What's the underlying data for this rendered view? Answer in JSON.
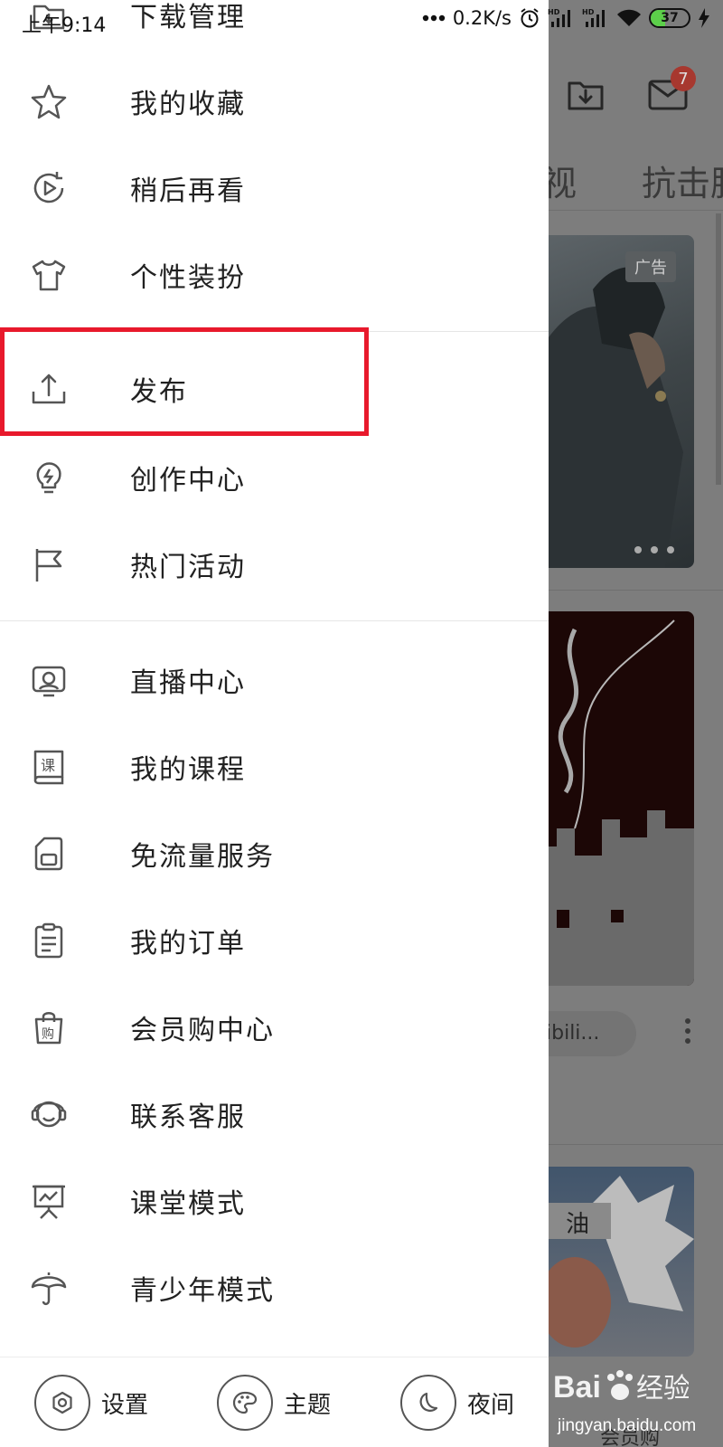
{
  "status_bar": {
    "time": "上午9:14",
    "network_speed": "0.2K/s",
    "battery_level": "37",
    "icons": [
      "dots-icon",
      "alarm-icon",
      "signal-hd-icon",
      "signal-hd-icon",
      "wifi-icon",
      "battery-icon",
      "charging-icon"
    ]
  },
  "background": {
    "tabs": [
      "视",
      "抗击肺"
    ],
    "ad_badge": "广告",
    "card_text": "ibili...",
    "mail_badge": "7",
    "bottom_partial": "会员购"
  },
  "drawer": {
    "items_top": [
      {
        "label": "下载管理",
        "icon": "download-folder-icon"
      },
      {
        "label": "我的收藏",
        "icon": "star-icon"
      },
      {
        "label": "稍后再看",
        "icon": "watch-later-icon"
      },
      {
        "label": "个性装扮",
        "icon": "tshirt-icon"
      }
    ],
    "items_mid": [
      {
        "label": "发布",
        "icon": "upload-icon"
      },
      {
        "label": "创作中心",
        "icon": "lightbulb-icon"
      },
      {
        "label": "热门活动",
        "icon": "flag-icon"
      }
    ],
    "items_bottom": [
      {
        "label": "直播中心",
        "icon": "live-tv-icon"
      },
      {
        "label": "我的课程",
        "icon": "course-book-icon"
      },
      {
        "label": "免流量服务",
        "icon": "sim-card-icon"
      },
      {
        "label": "我的订单",
        "icon": "order-list-icon"
      },
      {
        "label": "会员购中心",
        "icon": "shopping-bag-icon"
      },
      {
        "label": "联系客服",
        "icon": "headset-icon"
      },
      {
        "label": "课堂模式",
        "icon": "classroom-board-icon"
      },
      {
        "label": "青少年模式",
        "icon": "umbrella-icon"
      }
    ],
    "bottom_bar": {
      "settings": "设置",
      "theme": "主题",
      "night": "夜间"
    }
  },
  "colors": {
    "highlight": "#e8192c",
    "mail_badge": "#e5483d",
    "battery_fill": "#5ccf4a"
  },
  "watermark": {
    "brand_text": "Bai经验",
    "url": "jingyan.baidu.com"
  }
}
